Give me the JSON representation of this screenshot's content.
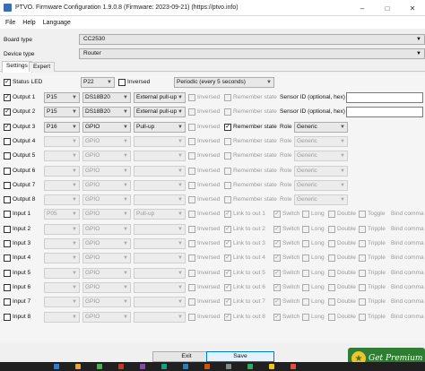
{
  "window": {
    "title": "PTVO. Firmware Configuration 1.9.0.8 (Firmware: 2023-09-21) (https://ptvo.info)",
    "minimize_icon": "minimize-icon",
    "maximize_icon": "maximize-icon",
    "close_icon": "close-icon"
  },
  "menu": {
    "file": "File",
    "help": "Help",
    "language": "Language"
  },
  "board": {
    "label": "Board type",
    "value": "CC2530"
  },
  "device": {
    "label": "Device type",
    "value": "Router"
  },
  "tabs": {
    "settings": "Settings",
    "expert": "Expert"
  },
  "status_led": {
    "checked": true,
    "label": "Status LED",
    "pin": "P22",
    "inversed_label": "Inversed",
    "inversed": false,
    "mode": "Periodic (every 5 seconds)"
  },
  "outputs": [
    {
      "label": "Output 1",
      "enabled": true,
      "pin": "P15",
      "type": "DS18B20",
      "pull": "External pull-up",
      "inversed": "Inversed",
      "remember": "Remember state",
      "extra_label": "Sensor ID (optional, hex)",
      "extra_kind": "input",
      "extra_value": ""
    },
    {
      "label": "Output 2",
      "enabled": true,
      "pin": "P15",
      "type": "DS18B20",
      "pull": "External pull-up",
      "inversed": "Inversed",
      "remember": "Remember state",
      "extra_label": "Sensor ID (optional, hex)",
      "extra_kind": "input",
      "extra_value": ""
    },
    {
      "label": "Output 3",
      "enabled": true,
      "pin": "P16",
      "type": "GPIO",
      "pull": "Pull-up",
      "inversed": "Inversed",
      "remember": "Remember state",
      "remember_checked": true,
      "extra_label": "Role",
      "extra_kind": "select",
      "extra_value": "Generic"
    },
    {
      "label": "Output 4",
      "enabled": false,
      "pin": "",
      "type": "GPIO",
      "pull": "",
      "inversed": "Inversed",
      "remember": "Remember state",
      "extra_label": "Role",
      "extra_kind": "select",
      "extra_value": "Generic"
    },
    {
      "label": "Output 5",
      "enabled": false,
      "pin": "",
      "type": "GPIO",
      "pull": "",
      "inversed": "Inversed",
      "remember": "Remember state",
      "extra_label": "Role",
      "extra_kind": "select",
      "extra_value": "Generic"
    },
    {
      "label": "Output 6",
      "enabled": false,
      "pin": "",
      "type": "GPIO",
      "pull": "",
      "inversed": "Inversed",
      "remember": "Remember state",
      "extra_label": "Role",
      "extra_kind": "select",
      "extra_value": "Generic"
    },
    {
      "label": "Output 7",
      "enabled": false,
      "pin": "",
      "type": "GPIO",
      "pull": "",
      "inversed": "Inversed",
      "remember": "Remember state",
      "extra_label": "Role",
      "extra_kind": "select",
      "extra_value": "Generic"
    },
    {
      "label": "Output 8",
      "enabled": false,
      "pin": "",
      "type": "GPIO",
      "pull": "",
      "inversed": "Inversed",
      "remember": "Remember state",
      "extra_label": "Role",
      "extra_kind": "select",
      "extra_value": "Generic"
    }
  ],
  "inputs": [
    {
      "label": "Input 1",
      "pin": "P05",
      "type": "GPIO",
      "pull": "Pull-up",
      "inversed": "Inversed",
      "link": "Link to out 1",
      "switch": "Switch",
      "long": "Long",
      "double": "Double",
      "extra": "Toggle",
      "bind": "Bind comma"
    },
    {
      "label": "Input 2",
      "pin": "",
      "type": "GPIO",
      "pull": "",
      "inversed": "Inversed",
      "link": "Link to out 2",
      "switch": "Switch",
      "long": "Long",
      "double": "Double",
      "extra": "Tripple",
      "bind": "Bind comma"
    },
    {
      "label": "Input 3",
      "pin": "",
      "type": "GPIO",
      "pull": "",
      "inversed": "Inversed",
      "link": "Link to out 3",
      "switch": "Switch",
      "long": "Long",
      "double": "Double",
      "extra": "Tripple",
      "bind": "Bind comma"
    },
    {
      "label": "Input 4",
      "pin": "",
      "type": "GPIO",
      "pull": "",
      "inversed": "Inversed",
      "link": "Link to out 4",
      "switch": "Switch",
      "long": "Long",
      "double": "Double",
      "extra": "Tripple",
      "bind": "Bind comma"
    },
    {
      "label": "Input 5",
      "pin": "",
      "type": "GPIO",
      "pull": "",
      "inversed": "Inversed",
      "link": "Link to out 5",
      "switch": "Switch",
      "long": "Long",
      "double": "Double",
      "extra": "Tripple",
      "bind": "Bind comma"
    },
    {
      "label": "Input 6",
      "pin": "",
      "type": "GPIO",
      "pull": "",
      "inversed": "Inversed",
      "link": "Link to out 6",
      "switch": "Switch",
      "long": "Long",
      "double": "Double",
      "extra": "Tripple",
      "bind": "Bind comma"
    },
    {
      "label": "Input 7",
      "pin": "",
      "type": "GPIO",
      "pull": "",
      "inversed": "Inversed",
      "link": "Link to out 7",
      "switch": "Switch",
      "long": "Long",
      "double": "Double",
      "extra": "Tripple",
      "bind": "Bind comma"
    },
    {
      "label": "Input 8",
      "pin": "",
      "type": "GPIO",
      "pull": "",
      "inversed": "Inversed",
      "link": "Link to out 8",
      "switch": "Switch",
      "long": "Long",
      "double": "Double",
      "extra": "Tripple",
      "bind": "Bind comma"
    }
  ],
  "buttons": {
    "exit": "Exit",
    "save": "Save"
  },
  "premium": {
    "label": "Get Premium",
    "icon": "star-icon"
  },
  "colors": {
    "accent": "#0078d7",
    "premium": "#2e7d32"
  }
}
